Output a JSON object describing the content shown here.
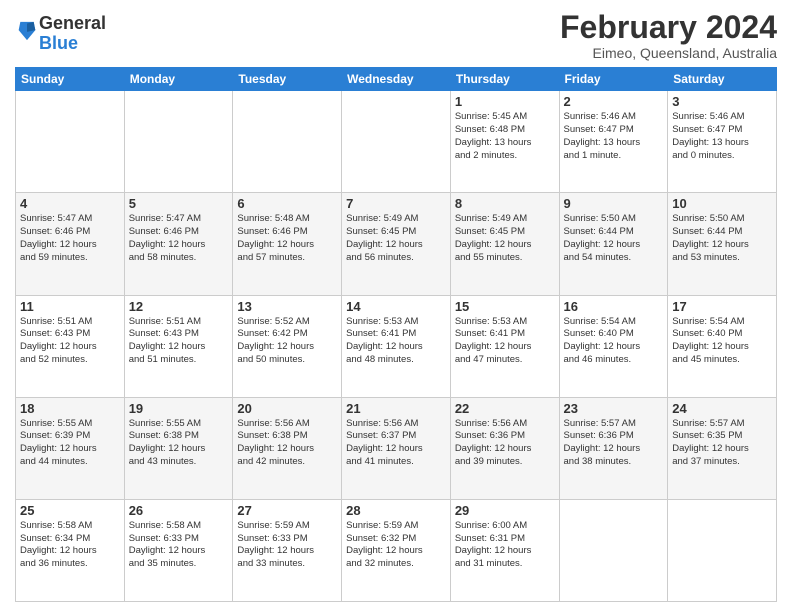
{
  "logo": {
    "general": "General",
    "blue": "Blue"
  },
  "title": "February 2024",
  "subtitle": "Eimeo, Queensland, Australia",
  "days_header": [
    "Sunday",
    "Monday",
    "Tuesday",
    "Wednesday",
    "Thursday",
    "Friday",
    "Saturday"
  ],
  "weeks": [
    [
      {
        "day": "",
        "info": ""
      },
      {
        "day": "",
        "info": ""
      },
      {
        "day": "",
        "info": ""
      },
      {
        "day": "",
        "info": ""
      },
      {
        "day": "1",
        "info": "Sunrise: 5:45 AM\nSunset: 6:48 PM\nDaylight: 13 hours\nand 2 minutes."
      },
      {
        "day": "2",
        "info": "Sunrise: 5:46 AM\nSunset: 6:47 PM\nDaylight: 13 hours\nand 1 minute."
      },
      {
        "day": "3",
        "info": "Sunrise: 5:46 AM\nSunset: 6:47 PM\nDaylight: 13 hours\nand 0 minutes."
      }
    ],
    [
      {
        "day": "4",
        "info": "Sunrise: 5:47 AM\nSunset: 6:46 PM\nDaylight: 12 hours\nand 59 minutes."
      },
      {
        "day": "5",
        "info": "Sunrise: 5:47 AM\nSunset: 6:46 PM\nDaylight: 12 hours\nand 58 minutes."
      },
      {
        "day": "6",
        "info": "Sunrise: 5:48 AM\nSunset: 6:46 PM\nDaylight: 12 hours\nand 57 minutes."
      },
      {
        "day": "7",
        "info": "Sunrise: 5:49 AM\nSunset: 6:45 PM\nDaylight: 12 hours\nand 56 minutes."
      },
      {
        "day": "8",
        "info": "Sunrise: 5:49 AM\nSunset: 6:45 PM\nDaylight: 12 hours\nand 55 minutes."
      },
      {
        "day": "9",
        "info": "Sunrise: 5:50 AM\nSunset: 6:44 PM\nDaylight: 12 hours\nand 54 minutes."
      },
      {
        "day": "10",
        "info": "Sunrise: 5:50 AM\nSunset: 6:44 PM\nDaylight: 12 hours\nand 53 minutes."
      }
    ],
    [
      {
        "day": "11",
        "info": "Sunrise: 5:51 AM\nSunset: 6:43 PM\nDaylight: 12 hours\nand 52 minutes."
      },
      {
        "day": "12",
        "info": "Sunrise: 5:51 AM\nSunset: 6:43 PM\nDaylight: 12 hours\nand 51 minutes."
      },
      {
        "day": "13",
        "info": "Sunrise: 5:52 AM\nSunset: 6:42 PM\nDaylight: 12 hours\nand 50 minutes."
      },
      {
        "day": "14",
        "info": "Sunrise: 5:53 AM\nSunset: 6:41 PM\nDaylight: 12 hours\nand 48 minutes."
      },
      {
        "day": "15",
        "info": "Sunrise: 5:53 AM\nSunset: 6:41 PM\nDaylight: 12 hours\nand 47 minutes."
      },
      {
        "day": "16",
        "info": "Sunrise: 5:54 AM\nSunset: 6:40 PM\nDaylight: 12 hours\nand 46 minutes."
      },
      {
        "day": "17",
        "info": "Sunrise: 5:54 AM\nSunset: 6:40 PM\nDaylight: 12 hours\nand 45 minutes."
      }
    ],
    [
      {
        "day": "18",
        "info": "Sunrise: 5:55 AM\nSunset: 6:39 PM\nDaylight: 12 hours\nand 44 minutes."
      },
      {
        "day": "19",
        "info": "Sunrise: 5:55 AM\nSunset: 6:38 PM\nDaylight: 12 hours\nand 43 minutes."
      },
      {
        "day": "20",
        "info": "Sunrise: 5:56 AM\nSunset: 6:38 PM\nDaylight: 12 hours\nand 42 minutes."
      },
      {
        "day": "21",
        "info": "Sunrise: 5:56 AM\nSunset: 6:37 PM\nDaylight: 12 hours\nand 41 minutes."
      },
      {
        "day": "22",
        "info": "Sunrise: 5:56 AM\nSunset: 6:36 PM\nDaylight: 12 hours\nand 39 minutes."
      },
      {
        "day": "23",
        "info": "Sunrise: 5:57 AM\nSunset: 6:36 PM\nDaylight: 12 hours\nand 38 minutes."
      },
      {
        "day": "24",
        "info": "Sunrise: 5:57 AM\nSunset: 6:35 PM\nDaylight: 12 hours\nand 37 minutes."
      }
    ],
    [
      {
        "day": "25",
        "info": "Sunrise: 5:58 AM\nSunset: 6:34 PM\nDaylight: 12 hours\nand 36 minutes."
      },
      {
        "day": "26",
        "info": "Sunrise: 5:58 AM\nSunset: 6:33 PM\nDaylight: 12 hours\nand 35 minutes."
      },
      {
        "day": "27",
        "info": "Sunrise: 5:59 AM\nSunset: 6:33 PM\nDaylight: 12 hours\nand 33 minutes."
      },
      {
        "day": "28",
        "info": "Sunrise: 5:59 AM\nSunset: 6:32 PM\nDaylight: 12 hours\nand 32 minutes."
      },
      {
        "day": "29",
        "info": "Sunrise: 6:00 AM\nSunset: 6:31 PM\nDaylight: 12 hours\nand 31 minutes."
      },
      {
        "day": "",
        "info": ""
      },
      {
        "day": "",
        "info": ""
      }
    ]
  ]
}
